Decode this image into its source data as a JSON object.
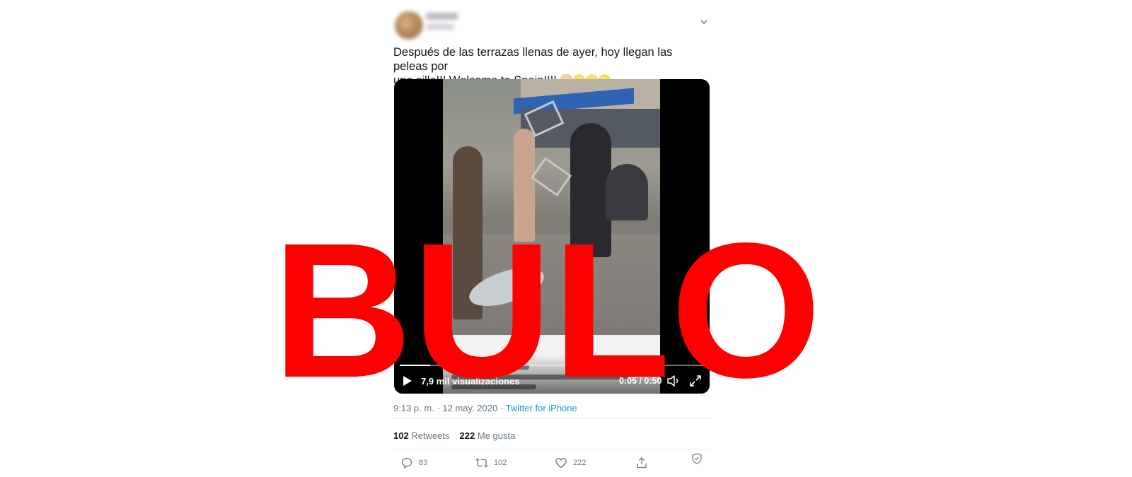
{
  "tweet": {
    "text_line1": "Después de las terrazas llenas de ayer, hoy llegan las peleas por",
    "text_line2": "una silla!!! Welcome to Spain!!!!",
    "emojis": [
      "fist-icon",
      "face-screaming-icon",
      "face-screaming-icon",
      "face-screaming-icon"
    ]
  },
  "video": {
    "views": "7,9 mil visualizaciones",
    "time": "0:05 / 0:50",
    "progress": 0.1,
    "caption_fragment": "Welcome fase 1. Terrazas al 50%"
  },
  "meta": {
    "time": "9:13 p. m.",
    "separator": "·",
    "date": "12 may. 2020",
    "source": "Twitter for iPhone"
  },
  "stats": {
    "retweets_count": "102",
    "retweets_label": "Retweets",
    "likes_count": "222",
    "likes_label": "Me gusta"
  },
  "actions": {
    "reply_count": "83",
    "retweet_count": "102",
    "like_count": "222"
  },
  "overlay": {
    "stamp": "BULO",
    "color": "#ff0000"
  },
  "colors": {
    "link": "#1b95e0",
    "muted": "#657786",
    "text": "#14171a"
  }
}
